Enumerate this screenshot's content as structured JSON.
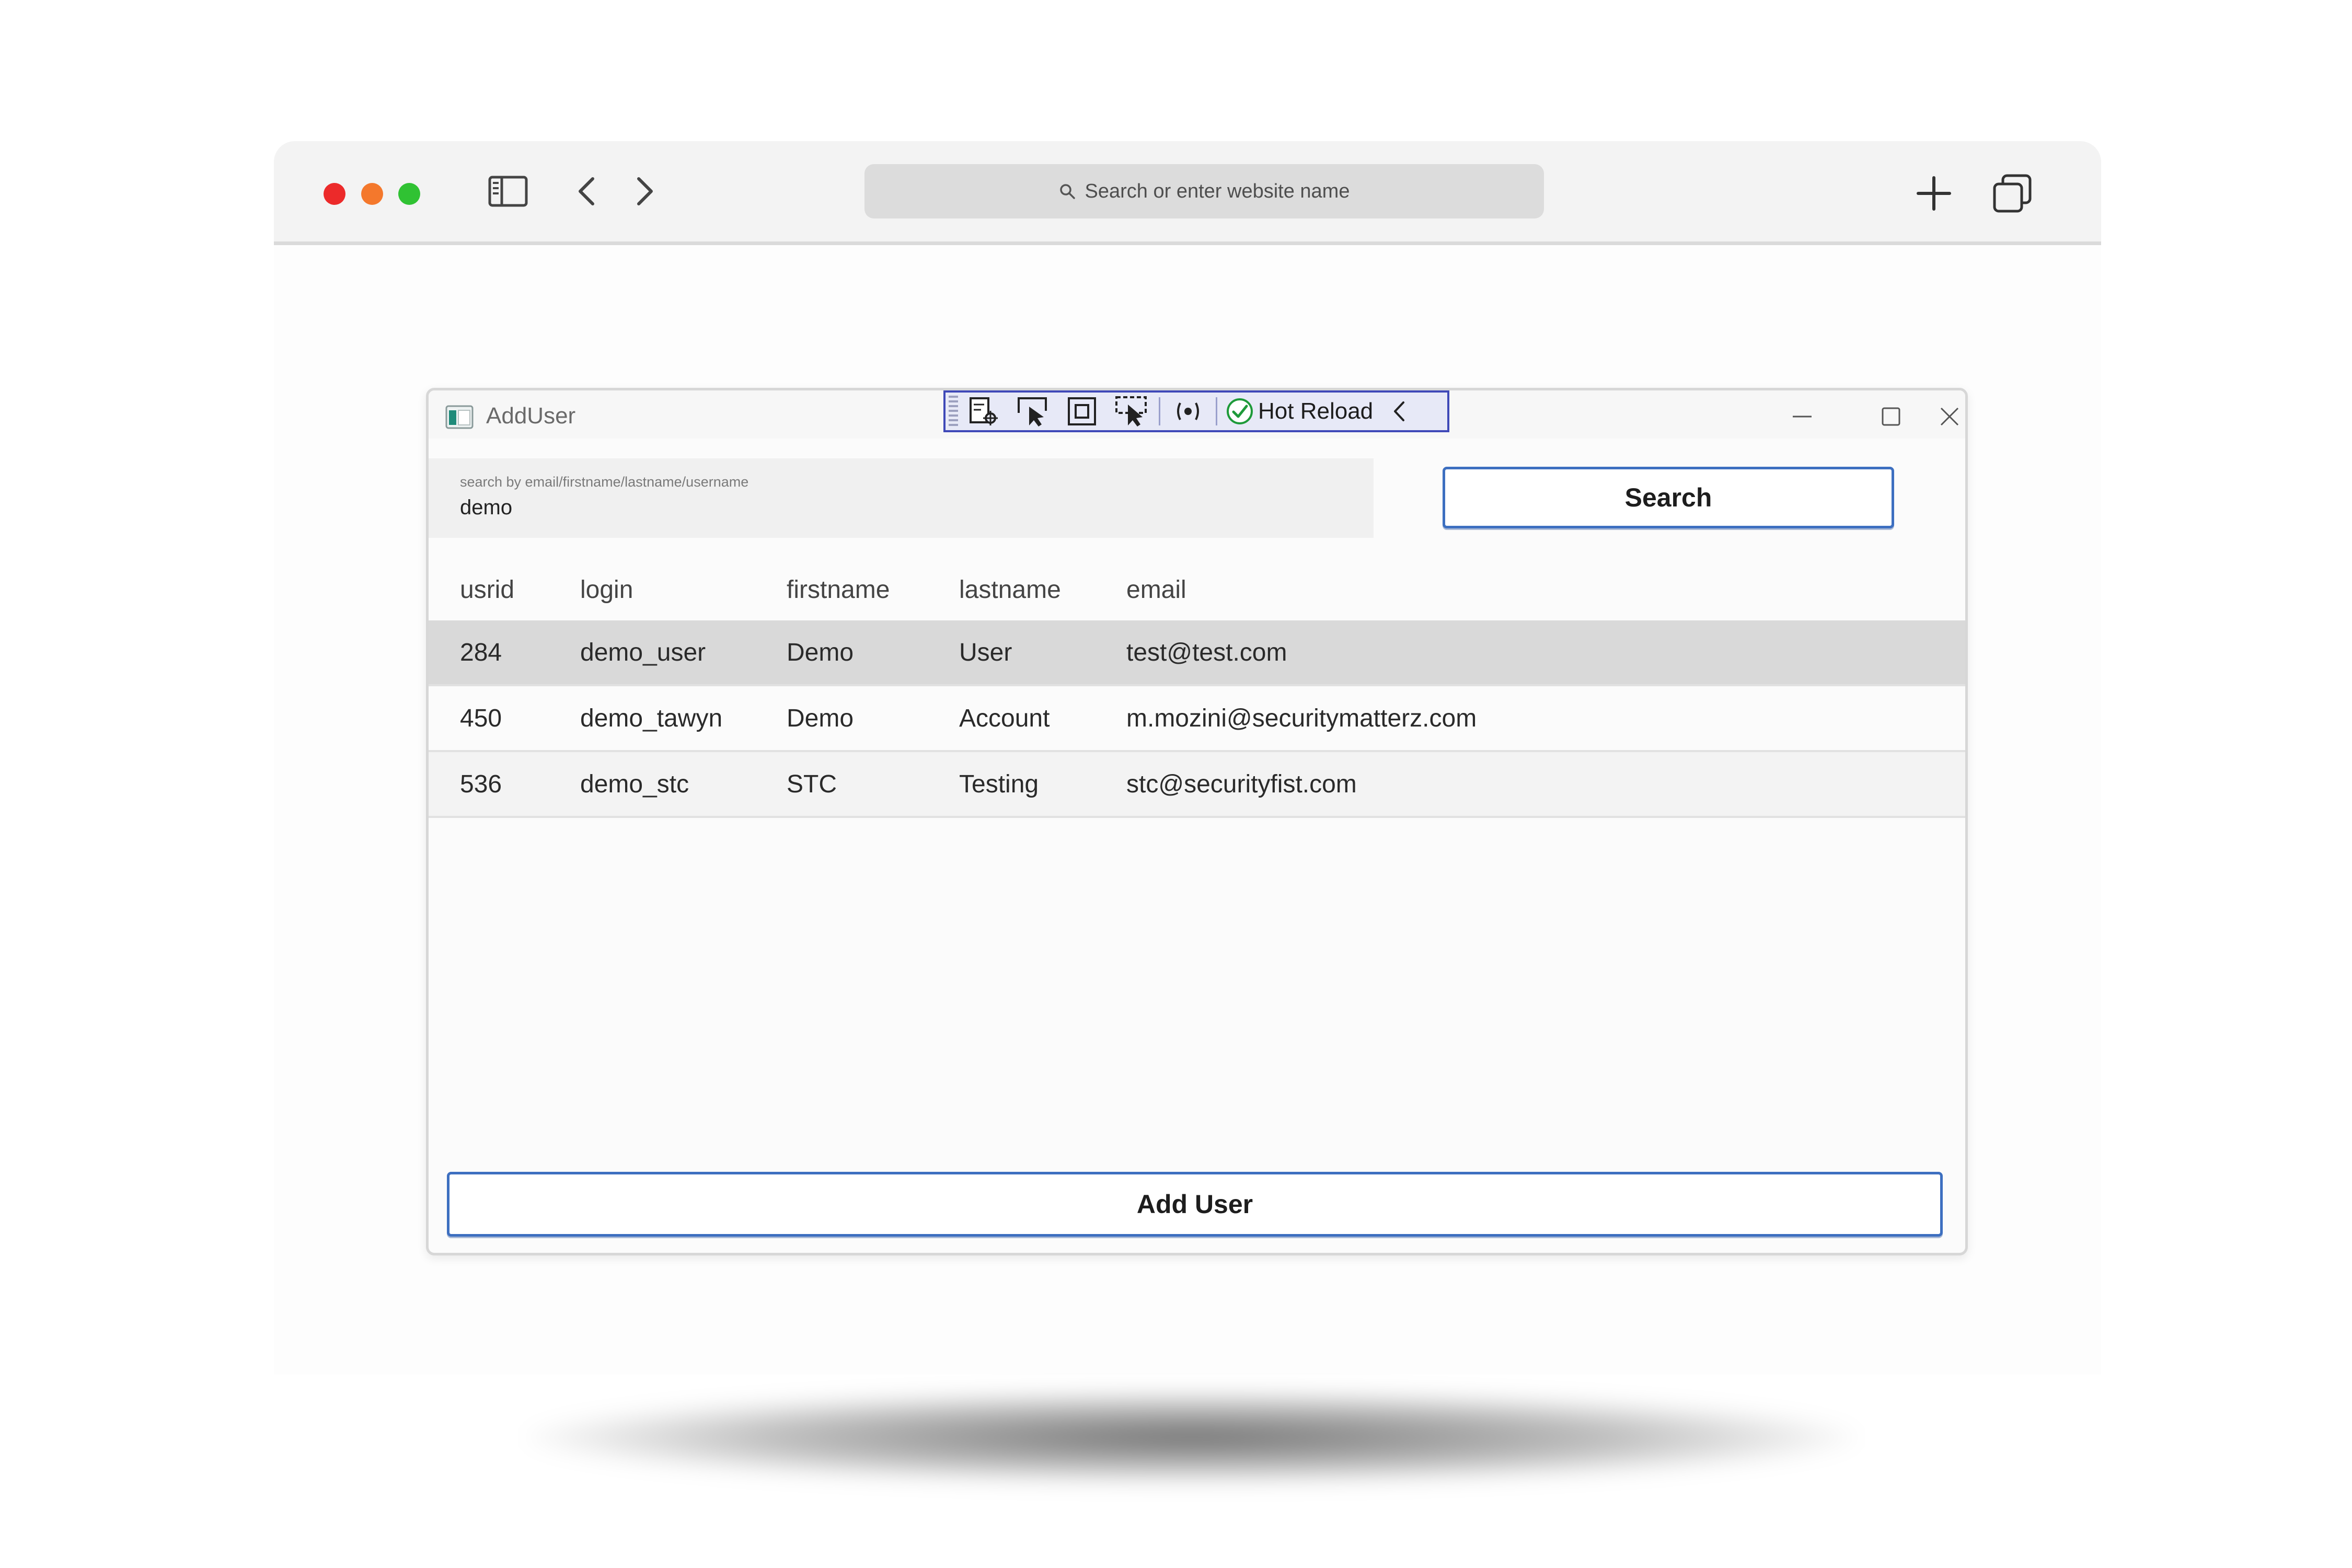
{
  "browser": {
    "address_placeholder": "Search or enter website name"
  },
  "app": {
    "title": "AddUser",
    "hot_reload_label": "Hot Reload",
    "search": {
      "hint": "search by email/firstname/lastname/username",
      "value": "demo",
      "button_label": "Search"
    },
    "table": {
      "columns": [
        "usrid",
        "login",
        "firstname",
        "lastname",
        "email"
      ],
      "rows": [
        {
          "usrid": "284",
          "login": "demo_user",
          "firstname": "Demo",
          "lastname": "User",
          "email": "test@test.com"
        },
        {
          "usrid": "450",
          "login": "demo_tawyn",
          "firstname": "Demo",
          "lastname": "Account",
          "email": "m.mozini@securitymatterz.com"
        },
        {
          "usrid": "536",
          "login": "demo_stc",
          "firstname": "STC",
          "lastname": "Testing",
          "email": "stc@securityfist.com"
        }
      ]
    },
    "add_button_label": "Add User"
  },
  "colors": {
    "accent_border": "#3d6fc0",
    "hot_reload_border": "#3f49b8",
    "selected_row": "#d9d9d9"
  },
  "icons": [
    "sidebar-icon",
    "back-chevron-icon",
    "forward-chevron-icon",
    "search-icon",
    "new-tab-plus-icon",
    "tabs-overview-icon",
    "app-window-icon",
    "minimize-icon",
    "maximize-icon",
    "close-icon",
    "hot-reload-check-icon"
  ]
}
